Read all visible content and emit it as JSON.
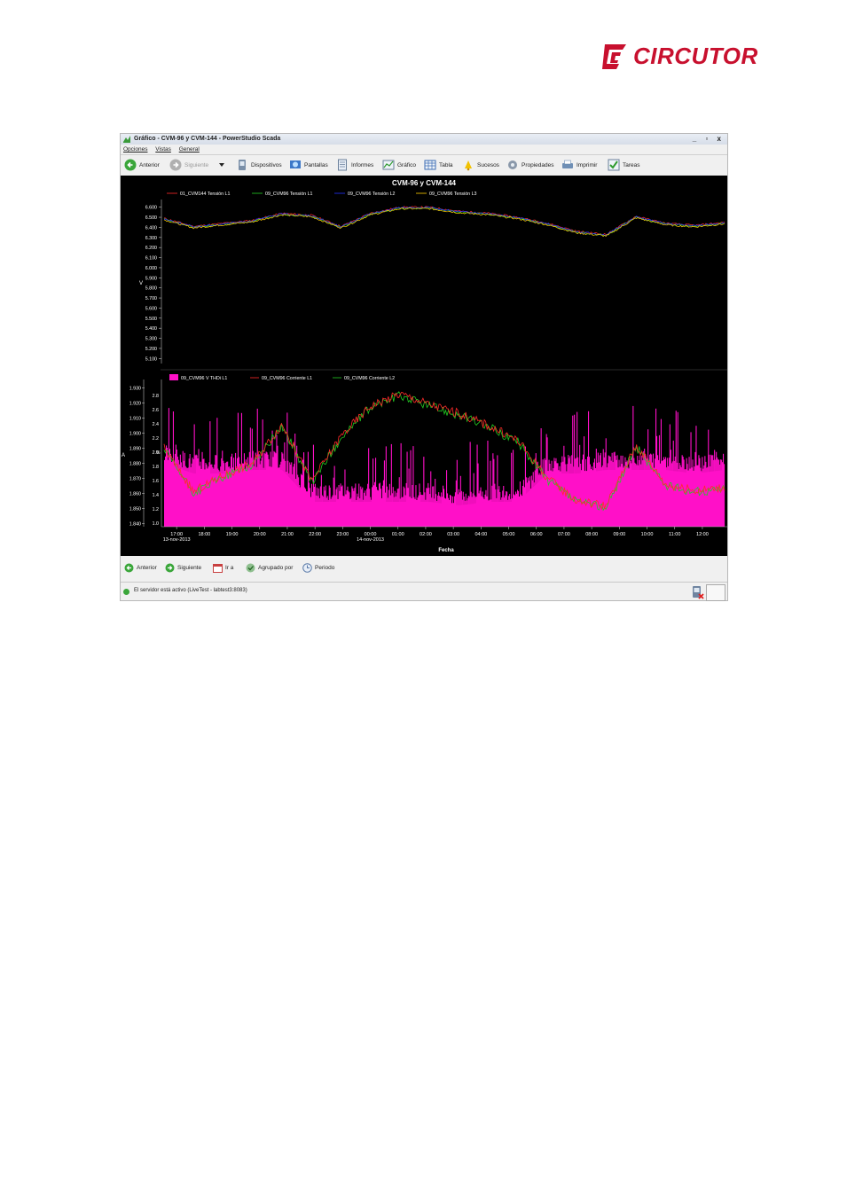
{
  "brand": {
    "name": "CIRCUTOR",
    "color": "#c8102e"
  },
  "window": {
    "title": "Gráfico - CVM-96 y CVM-144 - PowerStudio Scada",
    "controls": [
      "_",
      "▫",
      "x"
    ]
  },
  "menu": [
    "Opciones",
    "Vistas",
    "General"
  ],
  "toolbar": {
    "back": "Anterior",
    "next": "Siguiente",
    "devices": "Dispositivos",
    "screens": "Pantallas",
    "reports": "Informes",
    "chart": "Gráfico",
    "table": "Tabla",
    "events": "Sucesos",
    "properties": "Propiedades",
    "print": "Imprimir",
    "tasks": "Tareas"
  },
  "bottom_toolbar": {
    "back": "Anterior",
    "next": "Siguiente",
    "goto": "Ir a",
    "group_by": "Agrupado por",
    "period": "Periodo"
  },
  "status": {
    "text": "El servidor está activo (LiveTest - labtest3:8083)"
  },
  "chart_data": [
    {
      "type": "line",
      "title": "CVM-96 y CVM-144",
      "ylabel": "V",
      "ylim": [
        5050,
        6650
      ],
      "yticks": [
        "6.600",
        "6.500",
        "6.400",
        "6.300",
        "6.200",
        "6.100",
        "6.000",
        "5.900",
        "5.800",
        "5.700",
        "5.600",
        "5.500",
        "5.400",
        "5.300",
        "5.200",
        "5.100"
      ],
      "grid": false,
      "legend": "top",
      "x": [
        "17:00",
        "18:00",
        "19:00",
        "20:00",
        "21:00",
        "22:00",
        "23:00",
        "00:00",
        "01:00",
        "02:00",
        "03:00",
        "04:00",
        "05:00",
        "06:00",
        "07:00",
        "08:00",
        "09:00",
        "10:00",
        "11:00",
        "12:00"
      ],
      "series": [
        {
          "name": "01_CVM144 Tensión L1",
          "color": "#ff2a2a",
          "values": [
            6490,
            6410,
            6440,
            6470,
            6540,
            6520,
            6410,
            6540,
            6600,
            6600,
            6560,
            6540,
            6500,
            6440,
            6360,
            6330,
            6510,
            6440,
            6420,
            6450
          ]
        },
        {
          "name": "09_CVM96 Tensión L1",
          "color": "#22cc22",
          "values": [
            6480,
            6400,
            6430,
            6460,
            6530,
            6510,
            6400,
            6530,
            6590,
            6590,
            6550,
            6530,
            6490,
            6430,
            6350,
            6320,
            6500,
            6430,
            6410,
            6440
          ]
        },
        {
          "name": "09_CVM96 Tensión L2",
          "color": "#2233ff",
          "values": [
            6485,
            6405,
            6435,
            6465,
            6535,
            6515,
            6405,
            6535,
            6595,
            6595,
            6555,
            6535,
            6495,
            6435,
            6355,
            6325,
            6505,
            6435,
            6415,
            6445
          ]
        },
        {
          "name": "09_CVM96 Tensión L3",
          "color": "#ffcc00",
          "values": [
            6475,
            6395,
            6425,
            6455,
            6525,
            6505,
            6395,
            6525,
            6585,
            6585,
            6545,
            6525,
            6485,
            6425,
            6345,
            6315,
            6495,
            6425,
            6405,
            6435
          ]
        }
      ]
    },
    {
      "type": "line",
      "ylabel_left": "A",
      "ylabel_right": "%",
      "xlabel": "Fecha",
      "ylim_left": [
        1838,
        1932
      ],
      "yticks_left": [
        "1.930",
        "1.920",
        "1.910",
        "1.900",
        "1.890",
        "1.880",
        "1.870",
        "1.860",
        "1.850",
        "1.840"
      ],
      "ylim_right": [
        0.95,
        2.95
      ],
      "yticks_right": [
        "2.8",
        "2.6",
        "2.4",
        "2.2",
        "2.0",
        "1.8",
        "1.6",
        "1.4",
        "1.2",
        "1.0"
      ],
      "grid": false,
      "legend": "top",
      "x": [
        "17:00",
        "18:00",
        "19:00",
        "20:00",
        "21:00",
        "22:00",
        "23:00",
        "00:00",
        "01:00",
        "02:00",
        "03:00",
        "04:00",
        "05:00",
        "06:00",
        "07:00",
        "08:00",
        "09:00",
        "10:00",
        "11:00",
        "12:00"
      ],
      "date_labels": [
        "13-nov-2013",
        "14-nov-2013"
      ],
      "series": [
        {
          "name": "09_CVM96 V THDi L1",
          "color": "#ff10c8",
          "axis": "right",
          "kind": "area",
          "values": [
            1.95,
            1.8,
            1.8,
            1.85,
            1.85,
            1.4,
            1.4,
            1.4,
            1.4,
            1.4,
            1.35,
            1.4,
            1.4,
            1.8,
            1.8,
            1.85,
            1.85,
            1.85,
            1.8,
            1.85
          ]
        },
        {
          "name": "09_CVM96 Corriente L1",
          "color": "#ff2a2a",
          "axis": "left",
          "values": [
            1890,
            1861,
            1872,
            1880,
            1906,
            1868,
            1898,
            1918,
            1926,
            1919,
            1913,
            1905,
            1895,
            1870,
            1855,
            1852,
            1892,
            1866,
            1862,
            1864
          ]
        },
        {
          "name": "09_CVM96 Corriente L2",
          "color": "#22cc22",
          "axis": "left",
          "values": [
            1889,
            1860,
            1871,
            1879,
            1905,
            1867,
            1897,
            1917,
            1925,
            1918,
            1912,
            1904,
            1894,
            1869,
            1854,
            1851,
            1891,
            1865,
            1861,
            1863
          ]
        }
      ]
    }
  ]
}
